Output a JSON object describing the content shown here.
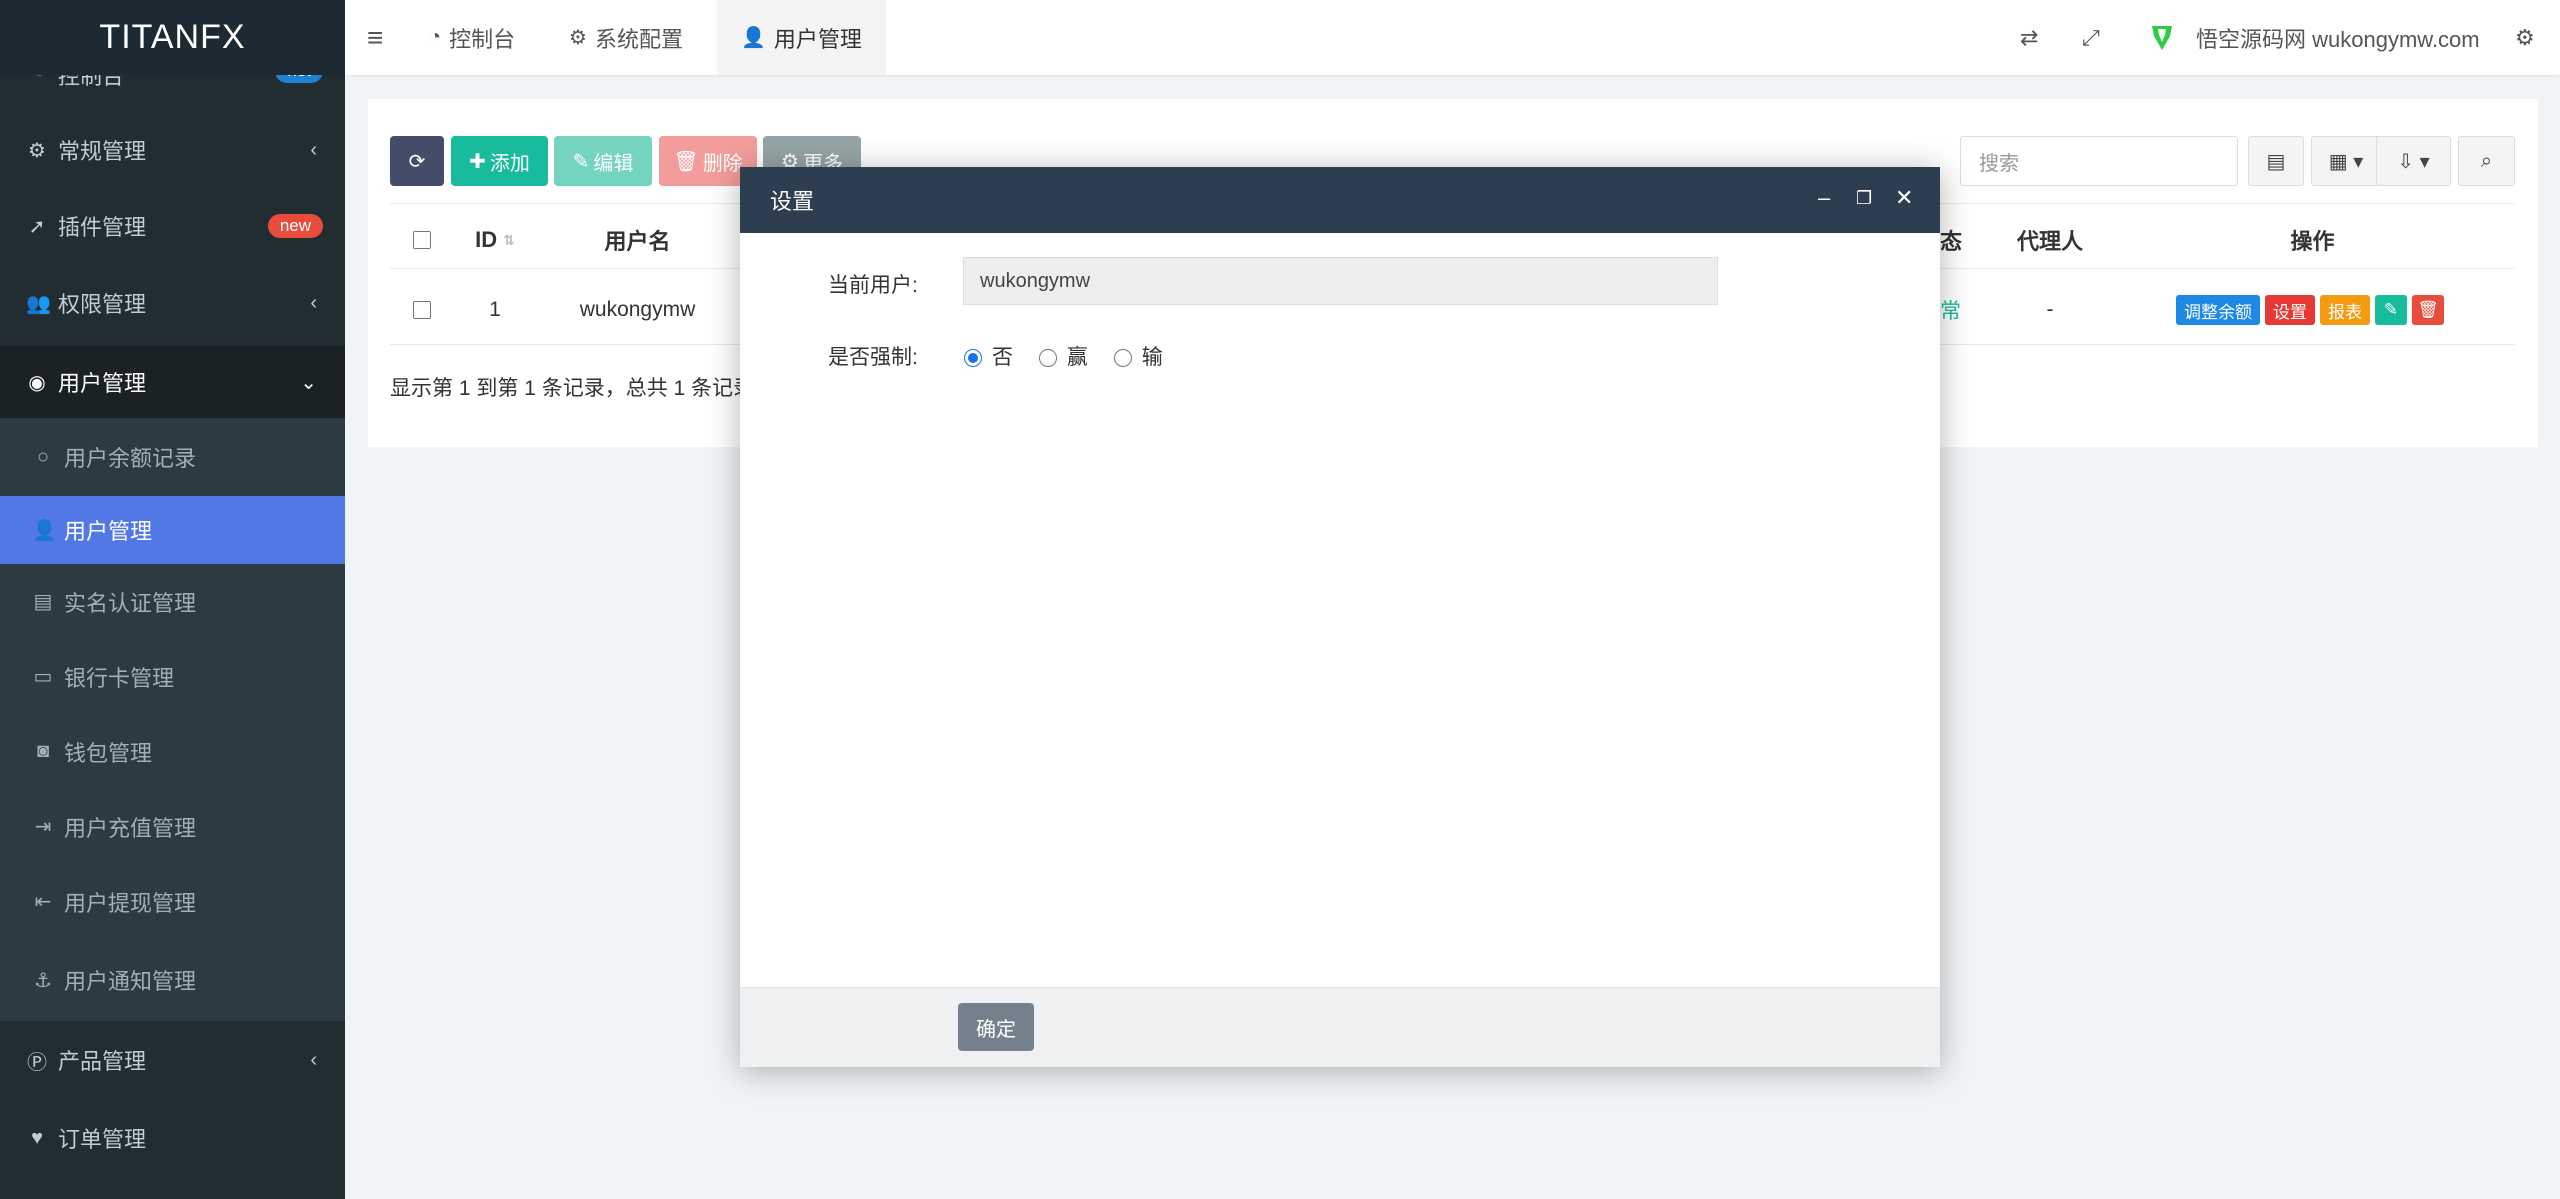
{
  "sidebar": {
    "logo": "TITANFX",
    "items": [
      {
        "label": "控制台",
        "badge": "hot",
        "badge_color": "#1e82d2"
      },
      {
        "label": "常规管理"
      },
      {
        "label": "插件管理",
        "badge": "new",
        "badge_color": "#e74c3c"
      },
      {
        "label": "权限管理"
      },
      {
        "label": "用户管理"
      },
      {
        "label": "用户余额记录"
      },
      {
        "label": "用户管理"
      },
      {
        "label": "实名认证管理"
      },
      {
        "label": "银行卡管理"
      },
      {
        "label": "钱包管理"
      },
      {
        "label": "用户充值管理"
      },
      {
        "label": "用户提现管理"
      },
      {
        "label": "用户通知管理"
      },
      {
        "label": "产品管理"
      },
      {
        "label": "订单管理"
      }
    ]
  },
  "topbar": {
    "tabs": [
      {
        "label": "控制台"
      },
      {
        "label": "系统配置"
      },
      {
        "label": "用户管理"
      }
    ],
    "site_name": "悟空源码网 wukongymw.com"
  },
  "toolbar": {
    "add": "添加",
    "edit": "编辑",
    "delete": "删除",
    "more": "更多",
    "search_placeholder": "搜索"
  },
  "table": {
    "headers": {
      "id": "ID",
      "username": "用户名",
      "status_fragment": "态",
      "agent": "代理人",
      "ops": "操作"
    },
    "row": {
      "id": "1",
      "username": "wukongymw",
      "status_fragment": "常",
      "agent": "-"
    },
    "row_ops": [
      {
        "label": "调整余额",
        "color": "#1e88e5"
      },
      {
        "label": "设置",
        "color": "#e53935"
      },
      {
        "label": "报表",
        "color": "#f39c12"
      }
    ],
    "footer": "显示第 1 到第 1 条记录，总共 1 条记录"
  },
  "modal": {
    "title": "设置",
    "current_user_label": "当前用户:",
    "current_user_value": "wukongymw",
    "force_label": "是否强制:",
    "options": [
      "否",
      "赢",
      "输"
    ],
    "selected_option": "否",
    "ok_label": "确定"
  },
  "colors": {
    "sidebar_bg": "#222d32",
    "active_item": "#5278e6",
    "modal_header": "#2c3e50",
    "add_btn": "#18bc9c",
    "refresh_btn": "#444c69"
  }
}
